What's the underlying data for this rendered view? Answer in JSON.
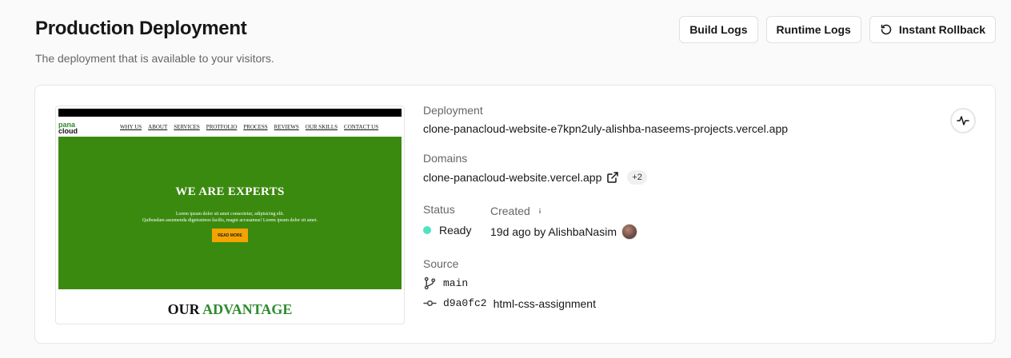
{
  "header": {
    "title": "Production Deployment",
    "subtitle": "The deployment that is available to your visitors."
  },
  "actions": {
    "build_logs": "Build Logs",
    "runtime_logs": "Runtime Logs",
    "instant_rollback": "Instant Rollback"
  },
  "preview": {
    "logo_line1": "pana",
    "logo_line2": "cloud",
    "nav_links": [
      "WHY US",
      "ABOUT",
      "SERVICES",
      "PROTFOLIO",
      "PROCESS",
      "REVIEWS",
      "OUR SKILLS",
      "CONTACT US"
    ],
    "hero_title": "WE ARE EXPERTS",
    "hero_text_1": "Lorem ipsum dolor sit amet consectetur, adipisicing elit.",
    "hero_text_2": "Quibusdam assumenda dignissimos facilis, magni accusamus! Lorem ipsum dolor sit amet.",
    "hero_button": "READ MORE",
    "advantage_1": "OUR",
    "advantage_2": "ADVANTAGE"
  },
  "deployment": {
    "label": "Deployment",
    "url": "clone-panacloud-website-e7kpn2uly-alishba-naseems-projects.vercel.app"
  },
  "domains": {
    "label": "Domains",
    "primary": "clone-panacloud-website.vercel.app",
    "extra_count": "+2"
  },
  "status": {
    "label": "Status",
    "value": "Ready",
    "color": "#50e3c2"
  },
  "created": {
    "label": "Created",
    "value": "19d ago by AlishbaNasim"
  },
  "source": {
    "label": "Source",
    "branch": "main",
    "commit_hash": "d9a0fc2",
    "commit_message": "html-css-assignment"
  },
  "icons": [
    "rollback-icon",
    "external-link-icon",
    "info-icon",
    "branch-icon",
    "commit-icon",
    "activity-icon"
  ]
}
